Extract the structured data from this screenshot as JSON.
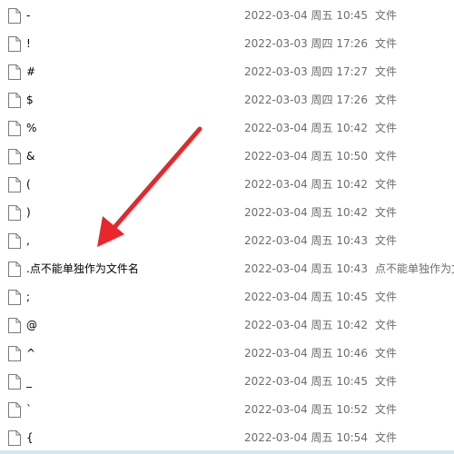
{
  "file_icon": "blank-file-icon",
  "annotation_arrow": {
    "icon": "red-arrow-icon",
    "color": "#e8262b"
  },
  "files": [
    {
      "name": "-",
      "date": "2022-03-04 周五 10:45",
      "type": "文件"
    },
    {
      "name": "!",
      "date": "2022-03-03 周四 17:26",
      "type": "文件"
    },
    {
      "name": "#",
      "date": "2022-03-03 周四 17:27",
      "type": "文件"
    },
    {
      "name": "$",
      "date": "2022-03-03 周四 17:26",
      "type": "文件"
    },
    {
      "name": "%",
      "date": "2022-03-04 周五 10:42",
      "type": "文件"
    },
    {
      "name": "&",
      "date": "2022-03-04 周五 10:50",
      "type": "文件"
    },
    {
      "name": "(",
      "date": "2022-03-04 周五 10:42",
      "type": "文件"
    },
    {
      "name": ")",
      "date": "2022-03-04 周五 10:42",
      "type": "文件"
    },
    {
      "name": ",",
      "date": "2022-03-04 周五 10:43",
      "type": "文件"
    },
    {
      "name": ".点不能单独作为文件名",
      "date": "2022-03-04 周五 10:43",
      "type": "点不能单独作为文件名"
    },
    {
      "name": ";",
      "date": "2022-03-04 周五 10:45",
      "type": "文件"
    },
    {
      "name": "@",
      "date": "2022-03-04 周五 10:42",
      "type": "文件"
    },
    {
      "name": "^",
      "date": "2022-03-04 周五 10:46",
      "type": "文件"
    },
    {
      "name": "_",
      "date": "2022-03-04 周五 10:45",
      "type": "文件"
    },
    {
      "name": "`",
      "date": "2022-03-04 周五 10:52",
      "type": "文件"
    },
    {
      "name": "{",
      "date": "2022-03-04 周五 10:54",
      "type": "文件"
    }
  ]
}
